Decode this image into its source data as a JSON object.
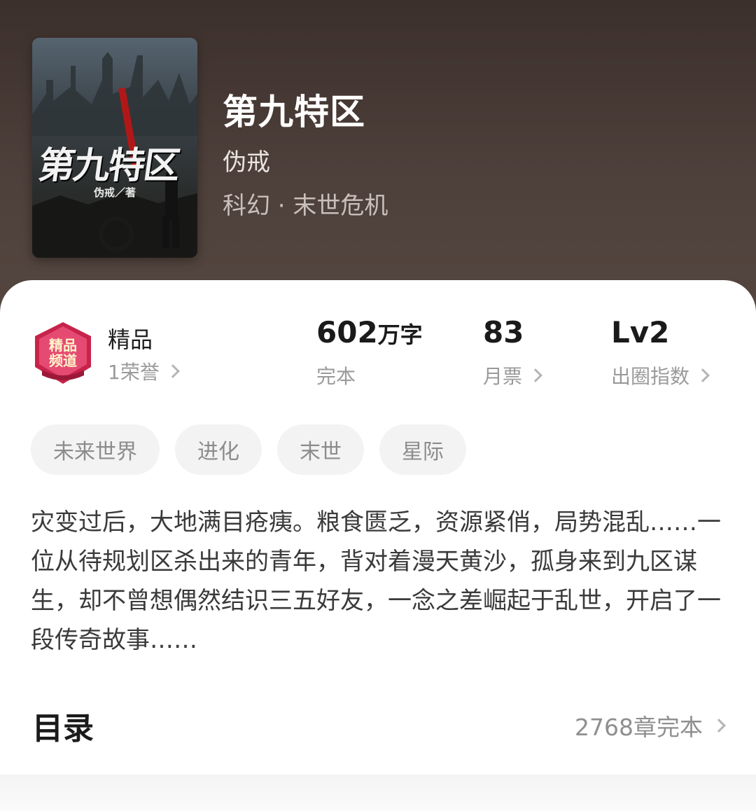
{
  "book": {
    "title": "第九特区",
    "author": "伪戒",
    "category": "科幻 · 末世危机",
    "cover": {
      "title": "第九特区",
      "author_line": "伪戒／著"
    }
  },
  "stats": {
    "badge_label": "精品",
    "badge_sub": "1荣誉",
    "badge_icon": "精品频道",
    "word_count": "602",
    "word_count_unit": "万字",
    "word_count_sub": "完本",
    "monthly_ticket": "83",
    "monthly_ticket_sub": "月票",
    "popularity": "Lv2",
    "popularity_sub": "出圈指数"
  },
  "tags": [
    "未来世界",
    "进化",
    "末世",
    "星际"
  ],
  "synopsis": "灾变过后，大地满目疮痍。粮食匮乏，资源紧俏，局势混乱……一位从待规划区杀出来的青年，背对着漫天黄沙，孤身来到九区谋生，却不曾想偶然结识三五好友，一念之差崛起于乱世，开启了一段传奇故事……",
  "toc": {
    "title": "目录",
    "count": "2768章完本"
  },
  "colors": {
    "header_bg": "#4a3d38",
    "badge_red": "#c8234a",
    "text_primary": "#1a1a1a",
    "text_secondary": "#9a9a9a"
  }
}
